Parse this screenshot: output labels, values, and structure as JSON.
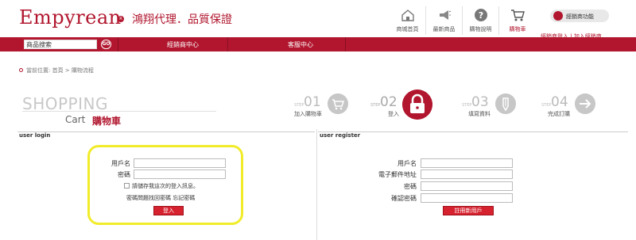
{
  "header": {
    "logo": "Empyrean",
    "logo_mark": "R",
    "tagline": "鴻翔代理．品質保證",
    "nav": [
      {
        "label": "商城首頁",
        "icon": "house-icon"
      },
      {
        "label": "最新商品",
        "icon": "megaphone-icon"
      },
      {
        "label": "購物說明",
        "icon": "question-icon"
      },
      {
        "label": "購物車",
        "icon": "cart-icon"
      }
    ],
    "member_button": "經銷商功能",
    "member_login": "經銷商登入",
    "member_sep": " | ",
    "member_join": "加入經銷商"
  },
  "redbar": {
    "search_value": "商品搜索",
    "search_button": "GO",
    "link1": "經銷商中心",
    "link2": "客服中心"
  },
  "breadcrumb": "當前位置: 首頁 > 購物流程",
  "title": {
    "shopping": "SHOPPING",
    "cart": "Cart",
    "cart_zh": "購物車"
  },
  "steps": [
    {
      "word": "STEP",
      "num": "01",
      "label": "加入購物車",
      "icon": "cart-icon",
      "active": false
    },
    {
      "word": "STEP",
      "num": "02",
      "label": "登入",
      "icon": "lock-icon",
      "active": true
    },
    {
      "word": "STEP",
      "num": "03",
      "label": "填寫資料",
      "icon": "pen-icon",
      "active": false
    },
    {
      "word": "STEP",
      "num": "04",
      "label": "完成訂購",
      "icon": "arrow-right-icon",
      "active": false
    }
  ],
  "login": {
    "title": "user login",
    "username_label": "用戶名",
    "password_label": "密碼",
    "remember": "請儲存我這次的登入訊息。",
    "forgot": "密碼問題找回密碼 忘記密碼",
    "submit": "登入"
  },
  "register": {
    "title": "user register",
    "username_label": "用戶名",
    "email_label": "電子郵件地址",
    "password_label": "密碼",
    "confirm_label": "確認密碼",
    "submit": "註冊新用戶"
  },
  "colors": {
    "brand": "#b1162e",
    "button": "#d6212e",
    "highlight": "#f1ec2a"
  }
}
